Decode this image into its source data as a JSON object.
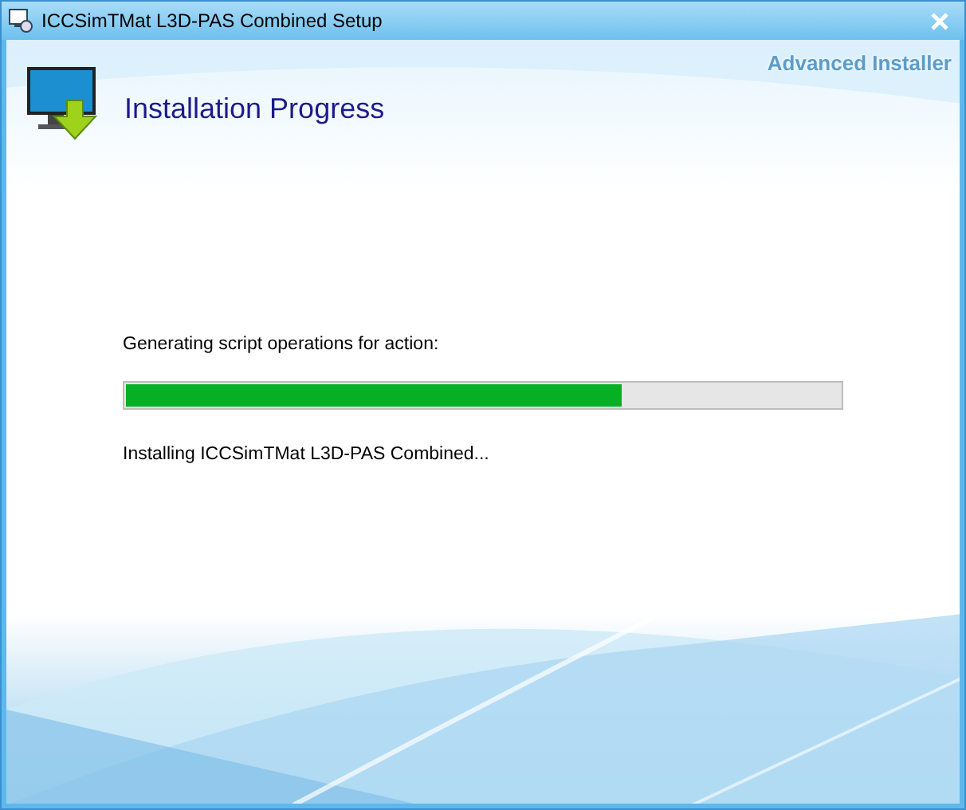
{
  "window": {
    "title": "ICCSimTMat L3D-PAS Combined Setup"
  },
  "brand": "Advanced Installer",
  "header": {
    "title": "Installation Progress"
  },
  "progress": {
    "label": "Generating script operations for action:",
    "level": 0.695,
    "status": "Installing ICCSimTMat L3D-PAS Combined..."
  }
}
